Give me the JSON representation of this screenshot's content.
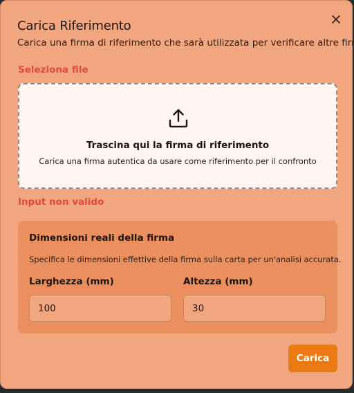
{
  "dialog": {
    "title": "Carica Riferimento",
    "subtitle": "Carica una firma di riferimento che sarà utilizzata per verificare altre firme",
    "close_icon": "close-icon"
  },
  "file": {
    "label": "Seleziona file",
    "dropzone_title": "Trascina qui la firma di riferimento",
    "dropzone_description": "Carica una firma autentica da usare come riferimento per il confronto",
    "icon": "upload-icon",
    "error": "Input non valido"
  },
  "dimensions": {
    "title": "Dimensioni reali della firma",
    "description": "Specifica le dimensioni effettive della firma sulla carta per un'analisi accurata.",
    "width_label": "Larghezza (mm)",
    "width_value": "100",
    "height_label": "Altezza (mm)",
    "height_value": "30"
  },
  "actions": {
    "submit_label": "Carica"
  },
  "colors": {
    "dialog_bg": "#f2a680",
    "section_bg": "#ec8f5e",
    "accent": "#ec7a12",
    "error": "#e14a3c"
  }
}
